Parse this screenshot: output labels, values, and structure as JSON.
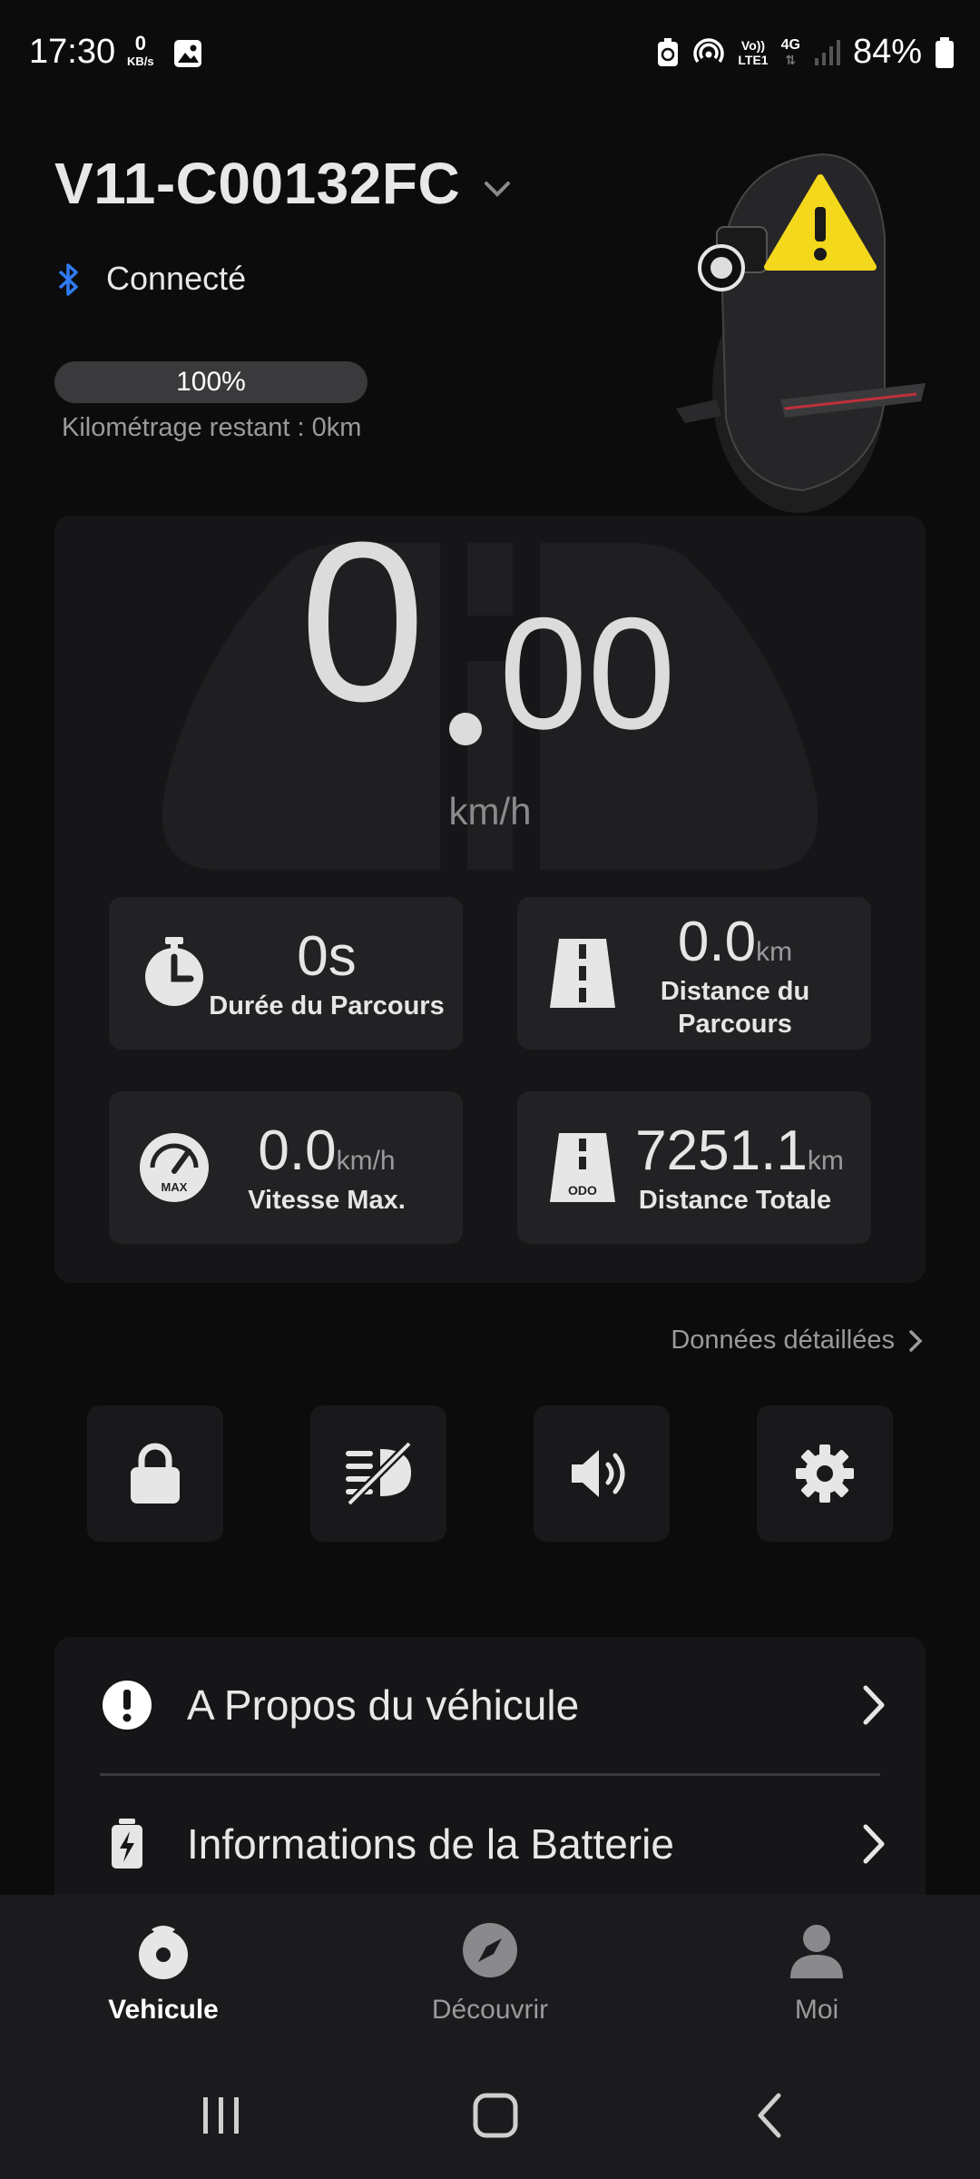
{
  "status_bar": {
    "time": "17:30",
    "kbs_value": "0",
    "kbs_unit": "KB/s",
    "volte": "Vo))",
    "lte": "LTE1",
    "network": "4G",
    "battery": "84%"
  },
  "header": {
    "device_name": "V11-C00132FC",
    "connection": "Connecté",
    "battery_level": "100%",
    "battery_fraction": 1.0,
    "range": "Kilométrage restant : 0km"
  },
  "speed": {
    "integer": "0",
    "decimals": "00",
    "unit": "km/h"
  },
  "stats": {
    "ride_time": {
      "value": "0s",
      "label": "Durée du Parcours"
    },
    "ride_distance": {
      "value": "0.0",
      "unit": "km",
      "label_line1": "Distance du",
      "label_line2": "Parcours"
    },
    "max_speed": {
      "value": "0.0",
      "unit": "km/h",
      "label": "Vitesse Max.",
      "icon_text": "MAX"
    },
    "total_distance": {
      "value": "7251.1",
      "unit": "km",
      "label": "Distance Totale",
      "icon_text": "ODO"
    }
  },
  "detail_link": "Données détaillées",
  "quick_actions": [
    "lock-icon",
    "light-off-icon",
    "speaker-icon",
    "gear-icon"
  ],
  "info_rows": [
    {
      "label": "A Propos du véhicule",
      "icon": "info-icon"
    },
    {
      "label": "Informations de la Batterie",
      "icon": "battery-icon"
    }
  ],
  "bottom_nav": [
    {
      "label": "Vehicule",
      "icon": "wheel-icon",
      "active": true
    },
    {
      "label": "Découvrir",
      "icon": "compass-icon",
      "active": false
    },
    {
      "label": "Moi",
      "icon": "person-icon",
      "active": false
    }
  ],
  "colors": {
    "background": "#0c0c0d",
    "card": "#161618",
    "tile": "#222224",
    "bluetooth": "#2f7bf5",
    "warning": "#f4d81c",
    "inactive": "#9a9a9c"
  }
}
